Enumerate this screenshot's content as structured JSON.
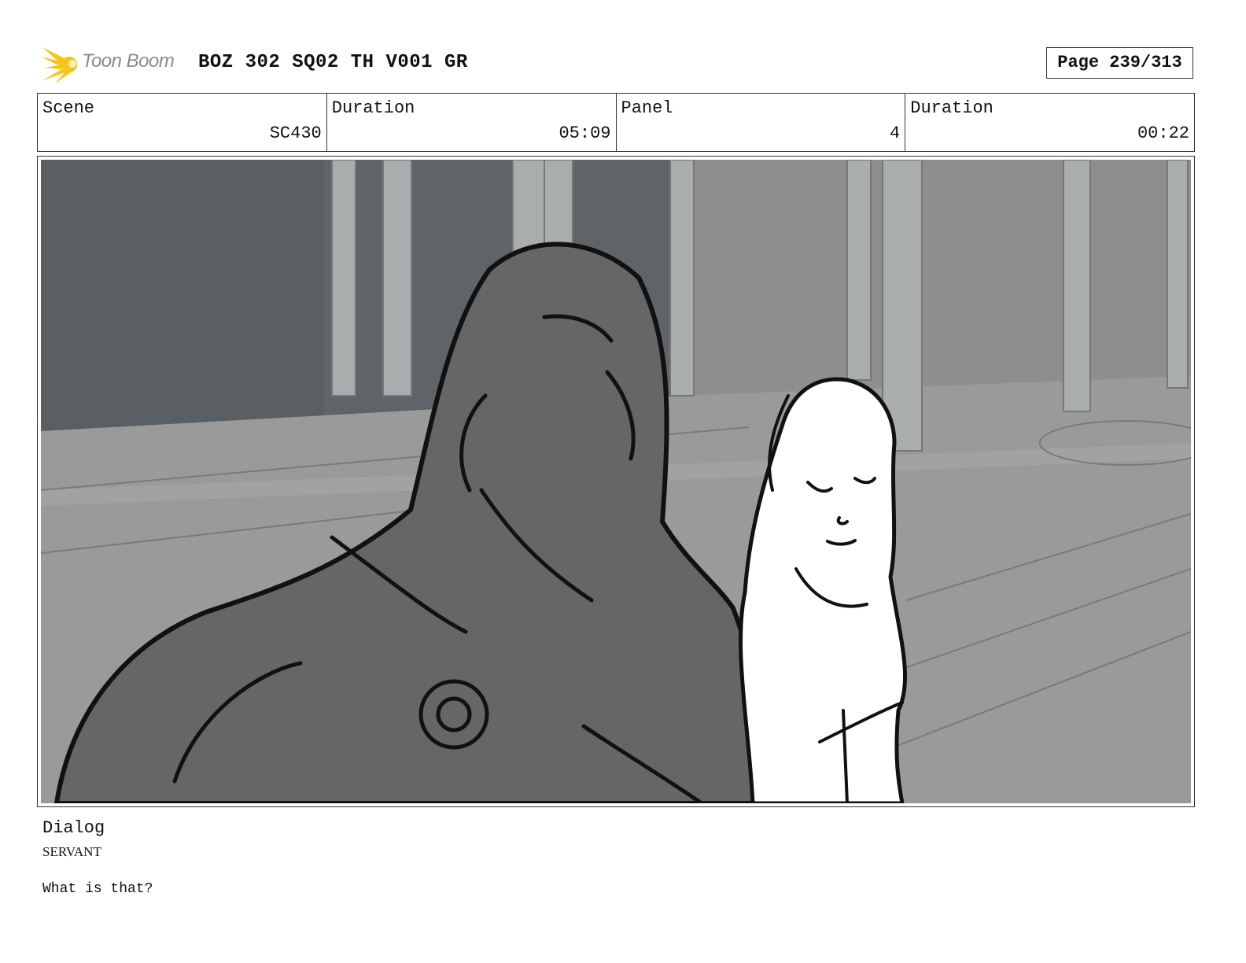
{
  "header": {
    "logo_text": "Toon Boom",
    "title": "BOZ 302 SQ02 TH V001 GR",
    "page_label": "Page 239/313"
  },
  "info": {
    "scene": {
      "label": "Scene",
      "value": "SC430"
    },
    "scene_duration": {
      "label": "Duration",
      "value": "05:09"
    },
    "panel": {
      "label": "Panel",
      "value": "4"
    },
    "panel_duration": {
      "label": "Duration",
      "value": "00:22"
    }
  },
  "dialog": {
    "label": "Dialog",
    "speaker": "SERVANT",
    "line": "What is that?"
  },
  "colors": {
    "logo_accent": "#f5c518",
    "panel_bg": "#8e8e8e",
    "warrior": "#666666"
  }
}
